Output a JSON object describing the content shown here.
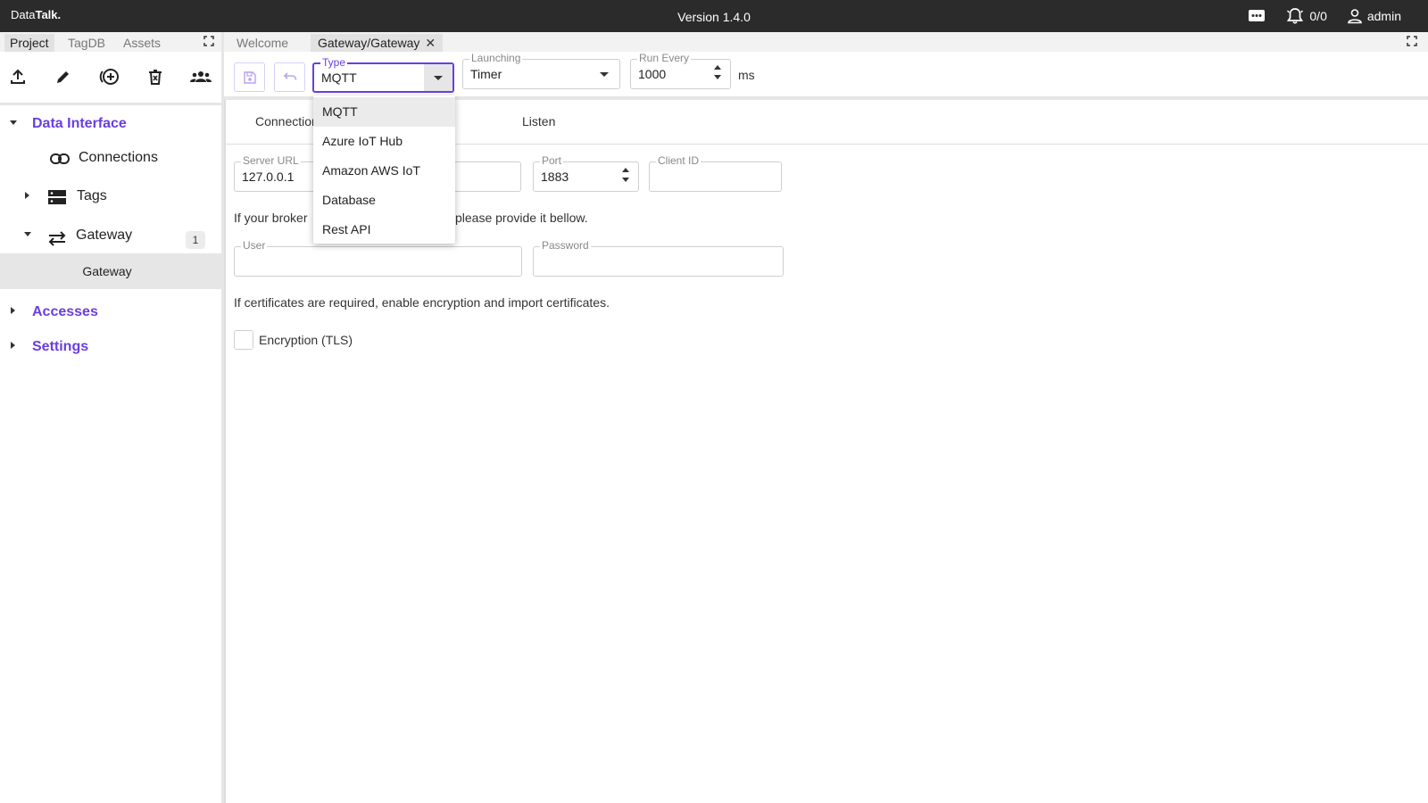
{
  "app": {
    "logo_prefix": "Data",
    "logo_bold": "Talk.",
    "version": "Version 1.4.0",
    "alarms_count": "0/0",
    "user": "admin"
  },
  "left_tabs": [
    "Project",
    "TagDB",
    "Assets"
  ],
  "left_toolbar_icons": [
    "upload-icon",
    "edit-icon",
    "add-circle-icon",
    "delete-icon",
    "group-icon"
  ],
  "tree": {
    "data_interface": "Data Interface",
    "connections": "Connections",
    "tags": "Tags",
    "gateway": "Gateway",
    "gateway_badge": "1",
    "gateway_child": "Gateway",
    "accesses": "Accesses",
    "settings": "Settings"
  },
  "doc_tabs": {
    "welcome": "Welcome",
    "active": "Gateway/Gateway",
    "close": "✕"
  },
  "toolbar": {
    "type_label": "Type",
    "type_value": "MQTT",
    "launching_label": "Launching",
    "launching_value": "Timer",
    "run_every_label": "Run Every",
    "run_every_value": "1000",
    "run_every_unit": "ms"
  },
  "inner_tabs": [
    "Connection",
    "Listen"
  ],
  "form": {
    "server_url_label": "Server URL",
    "server_url_value": "127.0.0.1",
    "port_label": "Port",
    "port_value": "1883",
    "client_id_label": "Client ID",
    "client_id_value": "",
    "broker_note_left": "If your broker",
    "broker_note_right": "please provide it bellow.",
    "user_label": "User",
    "password_label": "Password",
    "cert_note": "If certificates are required, enable encryption and import certificates.",
    "encryption_label": "Encryption (TLS)",
    "encryption_checked": false
  },
  "type_dropdown": {
    "options": [
      "MQTT",
      "Azure IoT Hub",
      "Amazon AWS IoT",
      "Database",
      "Rest API"
    ],
    "highlighted": "MQTT"
  },
  "colors": {
    "accent": "#6a3ee0",
    "topbar": "#2b2b2b"
  }
}
